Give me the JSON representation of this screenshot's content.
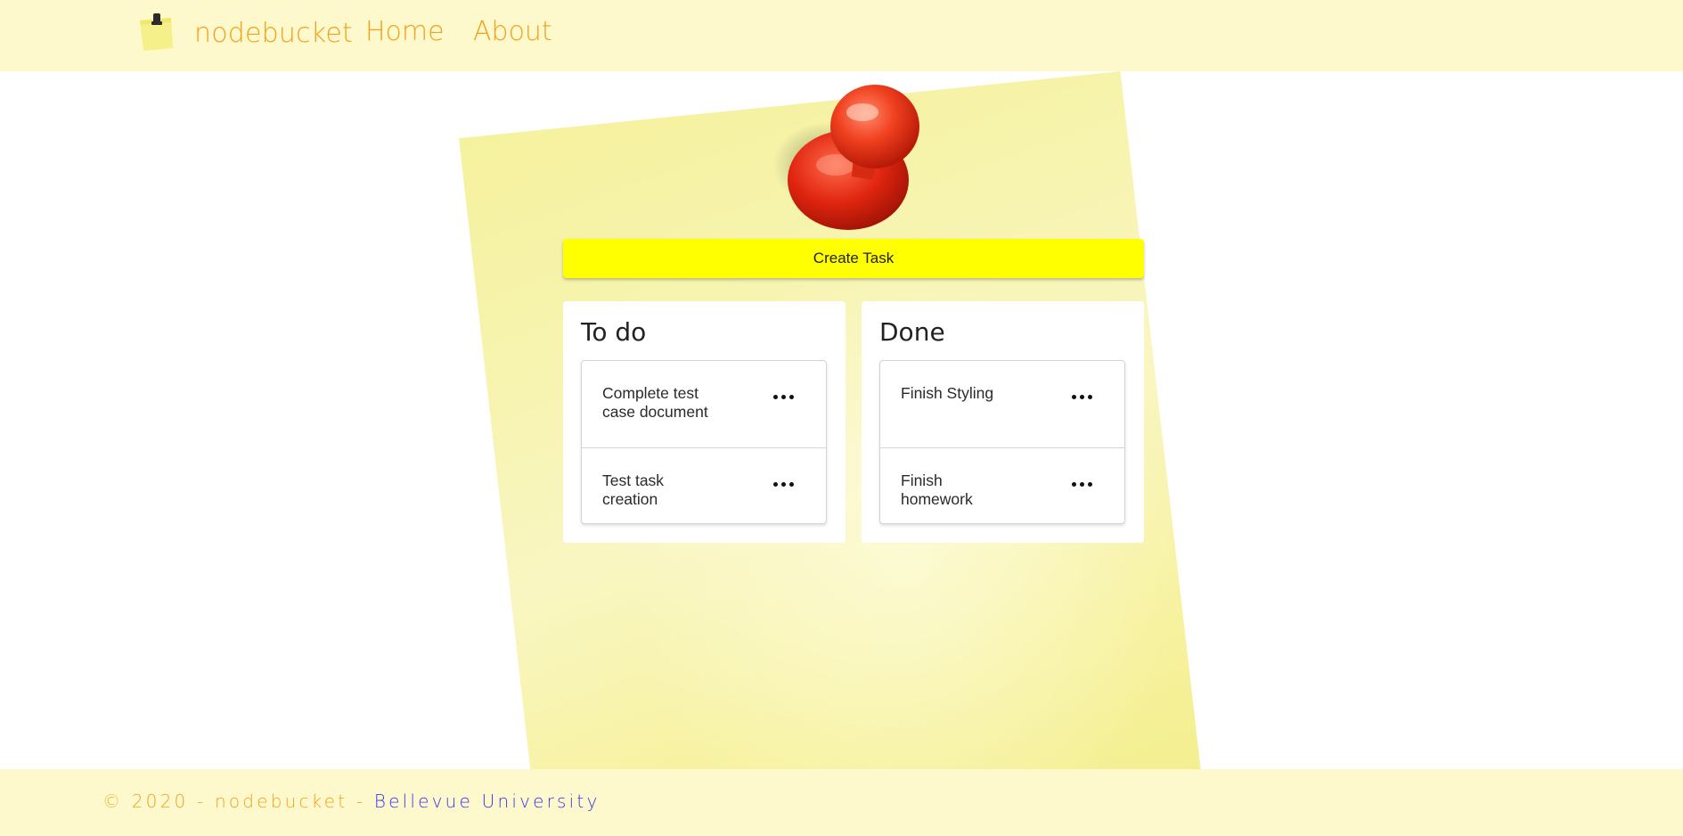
{
  "header": {
    "logo_icon": "sticky-note-clip-icon",
    "brand_name": "nodebucket",
    "nav": [
      {
        "label": "Home"
      },
      {
        "label": "About"
      }
    ]
  },
  "main": {
    "background_icon": "push-pin-icon",
    "create_button_label": "Create Task",
    "todo": {
      "title": "To do",
      "tasks": [
        {
          "text": "Complete test case document"
        },
        {
          "text": "Test task creation"
        }
      ]
    },
    "done": {
      "title": "Done",
      "tasks": [
        {
          "text": "Finish Styling"
        },
        {
          "text": "Finish homework"
        }
      ]
    },
    "task_menu_icon": "more-horizontal-icon"
  },
  "footer": {
    "copyright": "© 2020 - nodebucket - ",
    "link_label": "Bellevue University"
  },
  "colors": {
    "header_bg": "#fdf9cd",
    "brand": "#f2a21a",
    "create_button": "#ffff00",
    "footer_link": "#3b35e8"
  }
}
